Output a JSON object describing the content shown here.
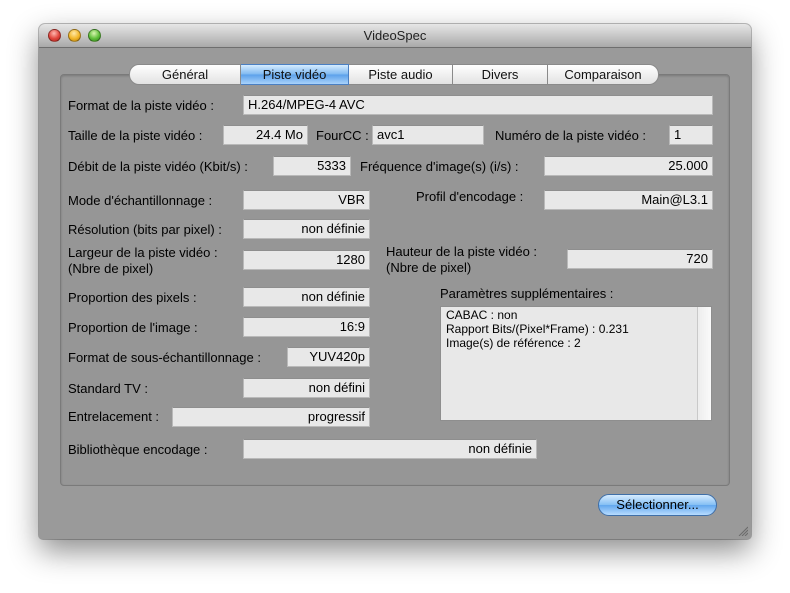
{
  "window": {
    "title": "VideoSpec"
  },
  "tabs": [
    "Général",
    "Piste vidéo",
    "Piste audio",
    "Divers",
    "Comparaison"
  ],
  "form": {
    "format_label": "Format de la piste vidéo :",
    "format_value": "H.264/MPEG-4 AVC",
    "taille_label": "Taille de la piste vidéo :",
    "taille_value": "24.4 Mo",
    "fourcc_label": "FourCC :",
    "fourcc_value": "avc1",
    "numero_label": "Numéro de la piste vidéo :",
    "numero_value": "1",
    "debit_label": "Débit de la piste vidéo (Kbit/s) :",
    "debit_value": "5333",
    "freq_label": "Fréquence d'image(s) (i/s) :",
    "freq_value": "25.000",
    "mode_label": "Mode d'échantillonnage :",
    "mode_value": "VBR",
    "profil_label": "Profil d'encodage :",
    "profil_value": "Main@L3.1",
    "resolution_label": "Résolution (bits par pixel) :",
    "resolution_value": "non définie",
    "largeur_label_1": "Largeur de la piste vidéo :",
    "largeur_label_2": "(Nbre de pixel)",
    "largeur_value": "1280",
    "hauteur_label_1": "Hauteur de la piste vidéo :",
    "hauteur_label_2": "(Nbre de pixel)",
    "hauteur_value": "720",
    "proportion_pixels_label": "Proportion des pixels :",
    "proportion_pixels_value": "non définie",
    "params_label": "Paramètres supplémentaires :",
    "params_lines": [
      "CABAC : non",
      "Rapport Bits/(Pixel*Frame) : 0.231",
      "Image(s) de référence : 2"
    ],
    "proportion_image_label": "Proportion de l'image :",
    "proportion_image_value": "16:9",
    "sous_ech_label": "Format de sous-échantillonnage :",
    "sous_ech_value": "YUV420p",
    "standard_label": "Standard TV :",
    "standard_value": "non défini",
    "entrelacement_label": "Entrelacement :",
    "entrelacement_value": "progressif",
    "bibliotheque_label": "Bibliothèque encodage :",
    "bibliotheque_value": "non définie"
  },
  "buttons": {
    "select": "Sélectionner..."
  }
}
